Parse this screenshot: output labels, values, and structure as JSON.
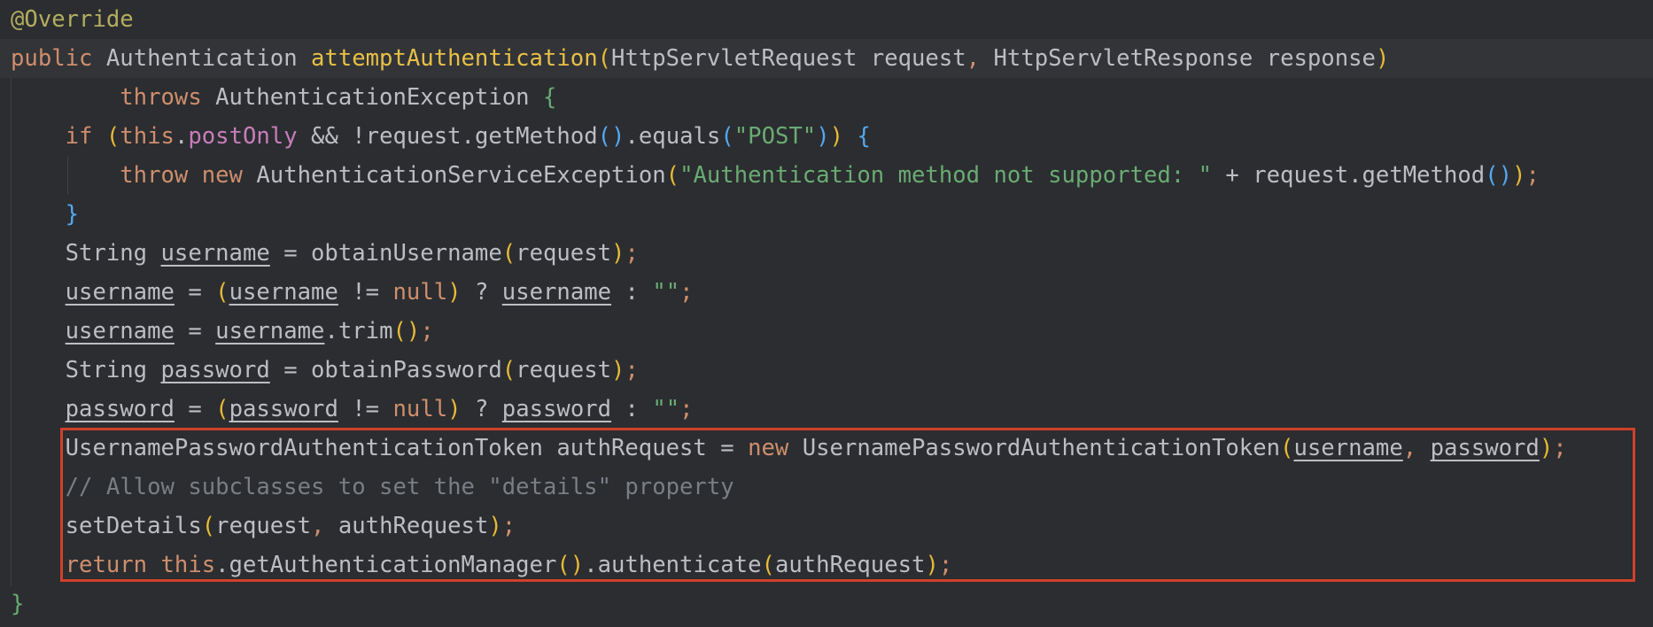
{
  "colors": {
    "background": "#2b2d30",
    "default": "#bcbec4",
    "keyword": "#cf8e6d",
    "annotation": "#b3ae60",
    "method_decl": "#e8c046",
    "string": "#6aab73",
    "comment": "#7a7e85",
    "field": "#c77dbb",
    "paren1": "#e8ba36",
    "paren2": "#54a8ef",
    "brace1": "#6aab73",
    "brace2": "#54a8ef",
    "highlight_border": "#d0402b"
  },
  "lines": [
    {
      "tokens": [
        {
          "t": "@Override",
          "c": "annotation"
        }
      ]
    },
    {
      "current": true,
      "tokens": [
        {
          "t": "public ",
          "c": "keyword"
        },
        {
          "t": "Authentication ",
          "c": "default"
        },
        {
          "t": "attemptAuthentication",
          "c": "method_decl"
        },
        {
          "t": "(",
          "c": "paren1"
        },
        {
          "t": "HttpServletRequest request",
          "c": "default"
        },
        {
          "t": ", ",
          "c": "keyword"
        },
        {
          "t": "HttpServletResponse response",
          "c": "default"
        },
        {
          "t": ")",
          "c": "paren1"
        }
      ]
    },
    {
      "tokens": [
        {
          "t": "        throws ",
          "c": "keyword"
        },
        {
          "t": "AuthenticationException ",
          "c": "default"
        },
        {
          "t": "{",
          "c": "brace1"
        }
      ]
    },
    {
      "tokens": [
        {
          "t": "    if ",
          "c": "keyword"
        },
        {
          "t": "(",
          "c": "paren1"
        },
        {
          "t": "this",
          "c": "keyword"
        },
        {
          "t": ".",
          "c": "default"
        },
        {
          "t": "postOnly",
          "c": "field"
        },
        {
          "t": " && !request.getMethod",
          "c": "default"
        },
        {
          "t": "()",
          "c": "paren2"
        },
        {
          "t": ".equals",
          "c": "default"
        },
        {
          "t": "(",
          "c": "paren2"
        },
        {
          "t": "\"POST\"",
          "c": "string"
        },
        {
          "t": ")",
          "c": "paren2"
        },
        {
          "t": ") ",
          "c": "paren1"
        },
        {
          "t": "{",
          "c": "brace2"
        }
      ]
    },
    {
      "tokens": [
        {
          "t": "        throw ",
          "c": "keyword"
        },
        {
          "t": "new ",
          "c": "keyword"
        },
        {
          "t": "AuthenticationServiceException",
          "c": "default"
        },
        {
          "t": "(",
          "c": "paren1"
        },
        {
          "t": "\"Authentication method not supported: \"",
          "c": "string"
        },
        {
          "t": " + request.getMethod",
          "c": "default"
        },
        {
          "t": "()",
          "c": "paren2"
        },
        {
          "t": ")",
          "c": "paren1"
        },
        {
          "t": ";",
          "c": "keyword"
        }
      ]
    },
    {
      "tokens": [
        {
          "t": "    }",
          "c": "brace2"
        }
      ]
    },
    {
      "tokens": [
        {
          "t": "    String ",
          "c": "default"
        },
        {
          "t": "username",
          "c": "default",
          "u": true
        },
        {
          "t": " = obtainUsername",
          "c": "default"
        },
        {
          "t": "(",
          "c": "paren1"
        },
        {
          "t": "request",
          "c": "default"
        },
        {
          "t": ")",
          "c": "paren1"
        },
        {
          "t": ";",
          "c": "keyword"
        }
      ]
    },
    {
      "tokens": [
        {
          "t": "    ",
          "c": "default"
        },
        {
          "t": "username",
          "c": "default",
          "u": true
        },
        {
          "t": " = ",
          "c": "default"
        },
        {
          "t": "(",
          "c": "paren1"
        },
        {
          "t": "username",
          "c": "default",
          "u": true
        },
        {
          "t": " != ",
          "c": "default"
        },
        {
          "t": "null",
          "c": "keyword"
        },
        {
          "t": ")",
          "c": "paren1"
        },
        {
          "t": " ? ",
          "c": "default"
        },
        {
          "t": "username",
          "c": "default",
          "u": true
        },
        {
          "t": " : ",
          "c": "default"
        },
        {
          "t": "\"\"",
          "c": "string"
        },
        {
          "t": ";",
          "c": "keyword"
        }
      ]
    },
    {
      "tokens": [
        {
          "t": "    ",
          "c": "default"
        },
        {
          "t": "username",
          "c": "default",
          "u": true
        },
        {
          "t": " = ",
          "c": "default"
        },
        {
          "t": "username",
          "c": "default",
          "u": true
        },
        {
          "t": ".trim",
          "c": "default"
        },
        {
          "t": "()",
          "c": "paren1"
        },
        {
          "t": ";",
          "c": "keyword"
        }
      ]
    },
    {
      "tokens": [
        {
          "t": "    String ",
          "c": "default"
        },
        {
          "t": "password",
          "c": "default",
          "u": true
        },
        {
          "t": " = obtainPassword",
          "c": "default"
        },
        {
          "t": "(",
          "c": "paren1"
        },
        {
          "t": "request",
          "c": "default"
        },
        {
          "t": ")",
          "c": "paren1"
        },
        {
          "t": ";",
          "c": "keyword"
        }
      ]
    },
    {
      "tokens": [
        {
          "t": "    ",
          "c": "default"
        },
        {
          "t": "password",
          "c": "default",
          "u": true
        },
        {
          "t": " = ",
          "c": "default"
        },
        {
          "t": "(",
          "c": "paren1"
        },
        {
          "t": "password",
          "c": "default",
          "u": true
        },
        {
          "t": " != ",
          "c": "default"
        },
        {
          "t": "null",
          "c": "keyword"
        },
        {
          "t": ")",
          "c": "paren1"
        },
        {
          "t": " ? ",
          "c": "default"
        },
        {
          "t": "password",
          "c": "default",
          "u": true
        },
        {
          "t": " : ",
          "c": "default"
        },
        {
          "t": "\"\"",
          "c": "string"
        },
        {
          "t": ";",
          "c": "keyword"
        }
      ]
    },
    {
      "tokens": [
        {
          "t": "    UsernamePasswordAuthenticationToken authRequest = ",
          "c": "default"
        },
        {
          "t": "new ",
          "c": "keyword"
        },
        {
          "t": "UsernamePasswordAuthenticationToken",
          "c": "default"
        },
        {
          "t": "(",
          "c": "paren1"
        },
        {
          "t": "username",
          "c": "default",
          "u": true
        },
        {
          "t": ", ",
          "c": "keyword"
        },
        {
          "t": "password",
          "c": "default",
          "u": true
        },
        {
          "t": ")",
          "c": "paren1"
        },
        {
          "t": ";",
          "c": "keyword"
        }
      ]
    },
    {
      "tokens": [
        {
          "t": "    // Allow subclasses to set the \"details\" property",
          "c": "comment"
        }
      ]
    },
    {
      "tokens": [
        {
          "t": "    setDetails",
          "c": "default"
        },
        {
          "t": "(",
          "c": "paren1"
        },
        {
          "t": "request",
          "c": "default"
        },
        {
          "t": ", ",
          "c": "keyword"
        },
        {
          "t": "authRequest",
          "c": "default"
        },
        {
          "t": ")",
          "c": "paren1"
        },
        {
          "t": ";",
          "c": "keyword"
        }
      ]
    },
    {
      "tokens": [
        {
          "t": "    return ",
          "c": "keyword"
        },
        {
          "t": "this",
          "c": "keyword"
        },
        {
          "t": ".getAuthenticationManager",
          "c": "default"
        },
        {
          "t": "()",
          "c": "paren1"
        },
        {
          "t": ".authenticate",
          "c": "default"
        },
        {
          "t": "(",
          "c": "paren1"
        },
        {
          "t": "authRequest",
          "c": "default"
        },
        {
          "t": ")",
          "c": "paren1"
        },
        {
          "t": ";",
          "c": "keyword"
        }
      ]
    },
    {
      "tokens": [
        {
          "t": "}",
          "c": "brace1"
        }
      ]
    }
  ]
}
